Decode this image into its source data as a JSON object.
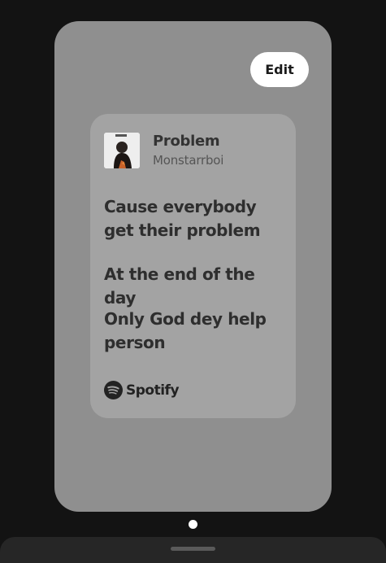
{
  "edit_button": {
    "label": "Edit"
  },
  "track": {
    "title": "Problem",
    "artist": "Monstarrboi",
    "album_art_icon": "album-cover"
  },
  "lyrics": [
    "Cause everybody get their problem",
    "At the end of the day",
    "Only God dey help person"
  ],
  "branding": {
    "logo_text": "Spotify"
  },
  "pager": {
    "current_page": 1,
    "total_pages": 1
  },
  "colors": {
    "screen_background": "#131313",
    "card_background": "#8f8f8f",
    "lyrics_card_background": "#a3a3a3",
    "button_background": "#ffffff"
  }
}
